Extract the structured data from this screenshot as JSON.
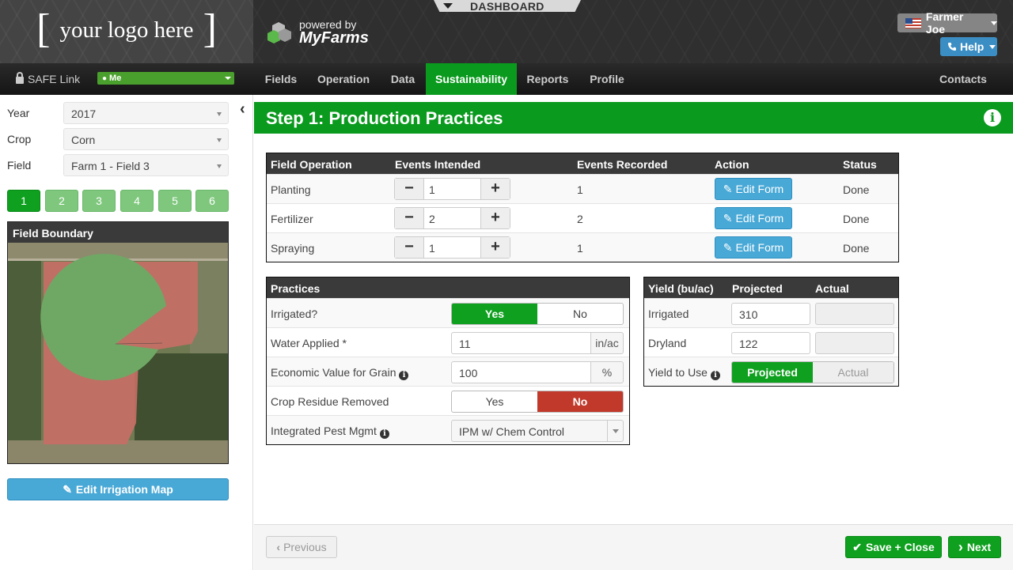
{
  "header": {
    "logo_left_bracket": "[",
    "logo_text": "your logo here",
    "logo_right_bracket": "]",
    "powered_by": "powered by",
    "brand": "MyFarms",
    "dashboard_tab": "DASHBOARD",
    "user_label": "Farmer Joe",
    "help_label": "Help"
  },
  "nav": {
    "safe_link": "SAFE Link",
    "me_select": "Me",
    "items": [
      "Fields",
      "Operation",
      "Data",
      "Sustainability",
      "Reports",
      "Profile"
    ],
    "active": "Sustainability",
    "contacts": "Contacts"
  },
  "sidebar": {
    "year_label": "Year",
    "year_value": "2017",
    "crop_label": "Crop",
    "crop_value": "Corn",
    "field_label": "Field",
    "field_value": "Farm 1 - Field 3",
    "steps": [
      "1",
      "2",
      "3",
      "4",
      "5",
      "6"
    ],
    "active_step": "1",
    "field_boundary_title": "Field Boundary",
    "edit_irrigation": "Edit Irrigation Map"
  },
  "main": {
    "step_title": "Step 1: Production Practices",
    "operations_table": {
      "headers": [
        "Field Operation",
        "Events Intended",
        "Events Recorded",
        "Action",
        "Status"
      ],
      "rows": [
        {
          "operation": "Planting",
          "intended": "1",
          "recorded": "1",
          "action": "Edit Form",
          "status": "Done"
        },
        {
          "operation": "Fertilizer",
          "intended": "2",
          "recorded": "2",
          "action": "Edit Form",
          "status": "Done"
        },
        {
          "operation": "Spraying",
          "intended": "1",
          "recorded": "1",
          "action": "Edit Form",
          "status": "Done"
        }
      ]
    },
    "practices": {
      "header": "Practices",
      "irrigated_label": "Irrigated?",
      "yes": "Yes",
      "no": "No",
      "irrigated_selected": "Yes",
      "water_label": "Water Applied *",
      "water_value": "11",
      "water_unit": "in/ac",
      "econ_label": "Economic Value for Grain",
      "econ_value": "100",
      "econ_unit": "%",
      "residue_label": "Crop Residue Removed",
      "residue_selected": "No",
      "ipm_label": "Integrated Pest Mgmt",
      "ipm_value": "IPM w/ Chem Control"
    },
    "yield": {
      "headers": [
        "Yield (bu/ac)",
        "Projected",
        "Actual"
      ],
      "irrigated_label": "Irrigated",
      "irrigated_projected": "310",
      "irrigated_actual": "",
      "dryland_label": "Dryland",
      "dryland_projected": "122",
      "dryland_actual": "",
      "use_label": "Yield to Use",
      "projected_btn": "Projected",
      "actual_btn": "Actual",
      "use_selected": "Projected"
    }
  },
  "footer": {
    "previous": "Previous",
    "save_close": "Save + Close",
    "next": "Next"
  },
  "colors": {
    "accent_green": "#0a9a1e",
    "button_blue": "#48a8d6",
    "danger_red": "#c0392b",
    "header_dark": "#2f2f2f"
  }
}
